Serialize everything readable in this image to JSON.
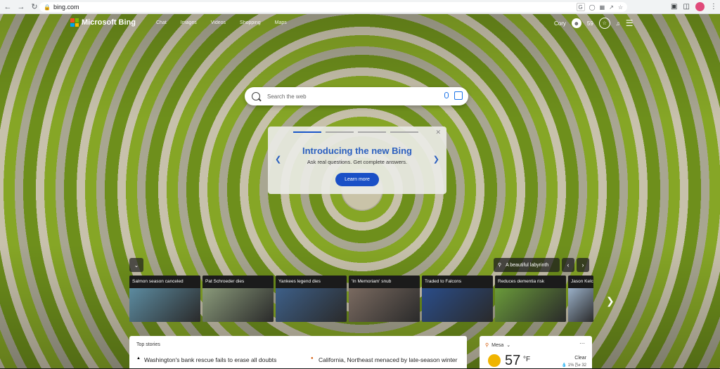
{
  "browser": {
    "url": "bing.com",
    "avatar_color": "#e04a7a"
  },
  "header": {
    "brand": "Microsoft Bing",
    "nav": [
      "Chat",
      "Images",
      "Videos",
      "Shopping",
      "Maps"
    ],
    "user_name": "Cory",
    "rewards_points": "59"
  },
  "search": {
    "placeholder": "Search the web"
  },
  "promo": {
    "title": "Introducing the new Bing",
    "subtitle": "Ask real questions. Get complete answers.",
    "button": "Learn more",
    "accent": "#1a4fc6"
  },
  "image_info": {
    "title": "A beautiful labyrinth"
  },
  "news_cards": [
    {
      "caption": "Salmon season canceled",
      "color": "#5c8ba0"
    },
    {
      "caption": "Pat Schroeder dies",
      "color": "#8a9a7a"
    },
    {
      "caption": "Yankees legend dies",
      "color": "#3d5f88"
    },
    {
      "caption": "'In Memoriam' snub",
      "color": "#7a6a60"
    },
    {
      "caption": "Traded to Falcons",
      "color": "#2a4d8a"
    },
    {
      "caption": "Reduces dementia risk",
      "color": "#6a9a3a"
    },
    {
      "caption": "Jason Kelce",
      "color": "#9ab0c8"
    }
  ],
  "top_stories": {
    "heading": "Top stories",
    "items": [
      "Washington's bank rescue fails to erase all doubts",
      "California, Northeast menaced by late-season winter"
    ]
  },
  "weather": {
    "location": "Mesa",
    "temp": "57",
    "unit": "°F",
    "condition": "Clear",
    "precip": "1%",
    "wind": "32"
  }
}
